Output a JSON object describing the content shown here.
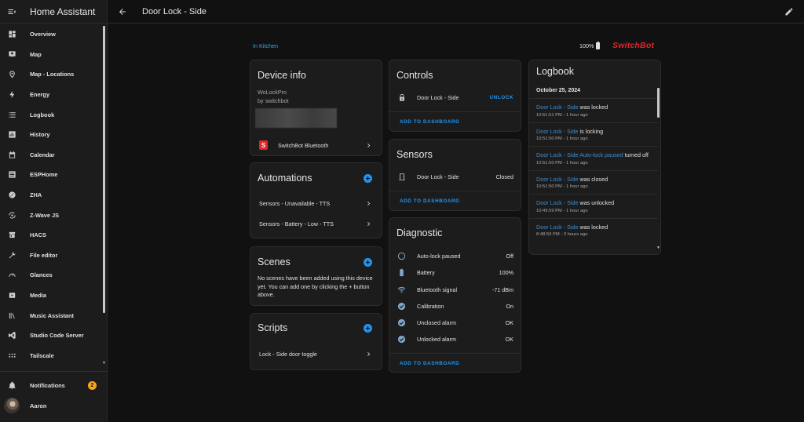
{
  "app": {
    "title": "Home Assistant"
  },
  "sidebar": {
    "items": [
      {
        "label": "Overview",
        "icon": "dashboard-icon"
      },
      {
        "label": "Map",
        "icon": "map-icon"
      },
      {
        "label": "Map - Locations",
        "icon": "map-marker-icon"
      },
      {
        "label": "Energy",
        "icon": "lightning-bolt-icon"
      },
      {
        "label": "Logbook",
        "icon": "logbook-icon"
      },
      {
        "label": "History",
        "icon": "history-chart-icon"
      },
      {
        "label": "Calendar",
        "icon": "calendar-icon"
      },
      {
        "label": "ESPHome",
        "icon": "esphome-icon"
      },
      {
        "label": "ZHA",
        "icon": "zigbee-icon"
      },
      {
        "label": "Z-Wave JS",
        "icon": "zwave-icon"
      },
      {
        "label": "HACS",
        "icon": "hacs-icon"
      },
      {
        "label": "File editor",
        "icon": "wrench-icon"
      },
      {
        "label": "Glances",
        "icon": "gauge-icon"
      },
      {
        "label": "Media",
        "icon": "media-icon"
      },
      {
        "label": "Music Assistant",
        "icon": "music-library-icon"
      },
      {
        "label": "Studio Code Server",
        "icon": "vscode-icon"
      },
      {
        "label": "Tailscale",
        "icon": "tailscale-icon"
      }
    ],
    "notifications": {
      "label": "Notifications",
      "count": "2"
    },
    "user": {
      "name": "Aaron"
    }
  },
  "header": {
    "title": "Door Lock - Side"
  },
  "device": {
    "area": "In Kitchen",
    "battery": "100%",
    "brand_logo": "SwitchBot",
    "brand_color": "#e0262b"
  },
  "device_info": {
    "title": "Device info",
    "model": "WoLockPro",
    "manufacturer": "by switchbot",
    "integration": "SwitchBot Bluetooth"
  },
  "automations": {
    "title": "Automations",
    "items": [
      "Sensors - Unavailable - TTS",
      "Sensors - Battery - Low - TTS"
    ]
  },
  "scenes": {
    "title": "Scenes",
    "empty_text": "No scenes have been added using this device yet. You can add one by clicking the + button above."
  },
  "scripts": {
    "title": "Scripts",
    "items": [
      "Lock - Side door toggle"
    ]
  },
  "controls": {
    "title": "Controls",
    "entity": "Door Lock - Side",
    "action": "UNLOCK",
    "add_to_dashboard": "ADD TO DASHBOARD"
  },
  "sensors": {
    "title": "Sensors",
    "entity": "Door Lock - Side",
    "state": "Closed",
    "add_to_dashboard": "ADD TO DASHBOARD"
  },
  "diagnostic": {
    "title": "Diagnostic",
    "rows": [
      {
        "label": "Auto-lock paused",
        "value": "Off",
        "icon": "circle-outline-icon"
      },
      {
        "label": "Battery",
        "value": "100%",
        "icon": "battery-icon"
      },
      {
        "label": "Bluetooth signal",
        "value": "-71 dBm",
        "icon": "wifi-signal-icon"
      },
      {
        "label": "Calibration",
        "value": "On",
        "icon": "check-circle-icon"
      },
      {
        "label": "Unclosed alarm",
        "value": "OK",
        "icon": "check-circle-icon"
      },
      {
        "label": "Unlocked alarm",
        "value": "OK",
        "icon": "check-circle-icon"
      }
    ],
    "add_to_dashboard": "ADD TO DASHBOARD"
  },
  "logbook": {
    "title": "Logbook",
    "date": "October 25, 2024",
    "entries": [
      {
        "entity": "Door Lock - Side",
        "text": " was locked",
        "time": "10:51:51 PM - 1 hour ago"
      },
      {
        "entity": "Door Lock - Side",
        "text": " is locking",
        "time": "10:51:50 PM - 1 hour ago"
      },
      {
        "entity": "Door Lock - Side Auto-lock paused",
        "text": " turned off",
        "time": "10:51:50 PM - 1 hour ago"
      },
      {
        "entity": "Door Lock - Side",
        "text": " was closed",
        "time": "10:51:50 PM - 1 hour ago"
      },
      {
        "entity": "Door Lock - Side",
        "text": " was unlocked",
        "time": "10:49:59 PM - 1 hour ago"
      },
      {
        "entity": "Door Lock - Side",
        "text": " was locked",
        "time": "8:48:59 PM - 3 hours ago"
      }
    ]
  },
  "colors": {
    "accent": "#2196f3",
    "link": "#3aa7e8",
    "badge": "#f6a81c",
    "background": "#111111",
    "card": "#1c1c1c"
  }
}
